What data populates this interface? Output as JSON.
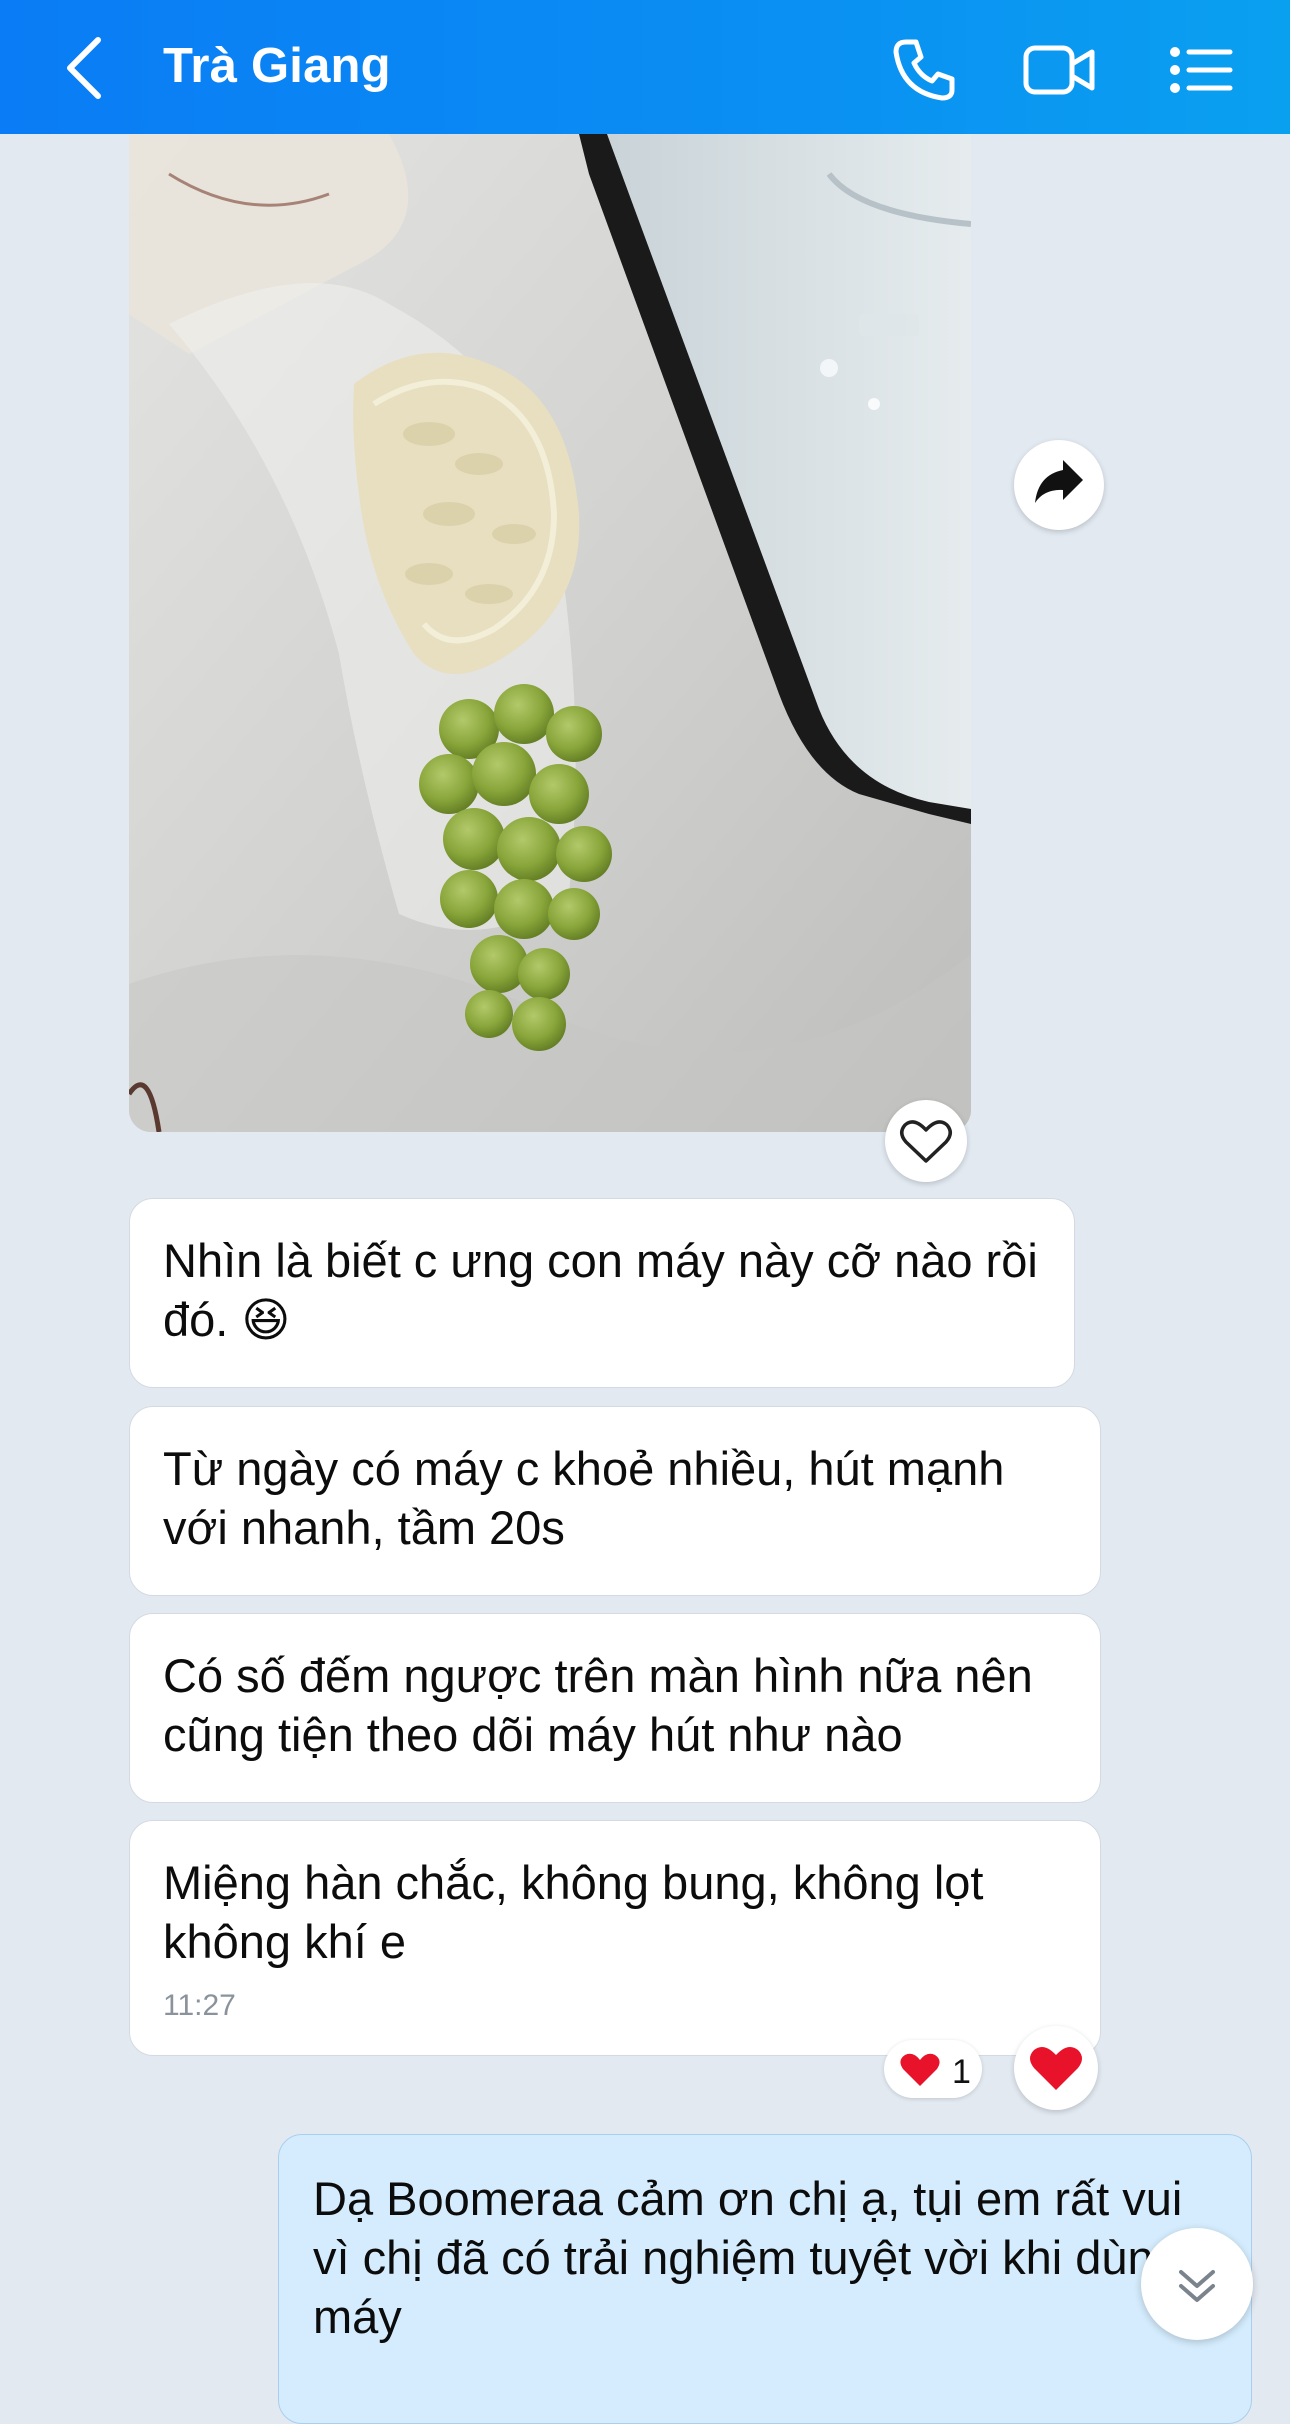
{
  "header": {
    "title": "Trà Giang"
  },
  "messages": [
    {
      "text": "Nhìn là biết c ưng con máy này cỡ nào rồi đó. 😆"
    },
    {
      "text": "Từ ngày có máy c khoẻ nhiều, hút mạnh với nhanh, tầm 20s"
    },
    {
      "text": "Có số đếm ngược trên màn hình nữa nên cũng tiện theo dõi máy hút như nào"
    },
    {
      "text": "Miệng hàn chắc, không bung, không lọt không khí e",
      "time": "11:27"
    }
  ],
  "reaction": {
    "emoji": "❤️",
    "count": "1"
  },
  "my_message": {
    "text": "Dạ Boomeraa cảm ơn chị ạ, tụi em rất vui vì chị đã có trải nghiệm tuyệt vời khi dùng máy"
  },
  "colors": {
    "header": "#0a8df3",
    "background": "#e2e9f1",
    "my_bubble": "#d4ecfd",
    "heart": "#e8132b"
  }
}
